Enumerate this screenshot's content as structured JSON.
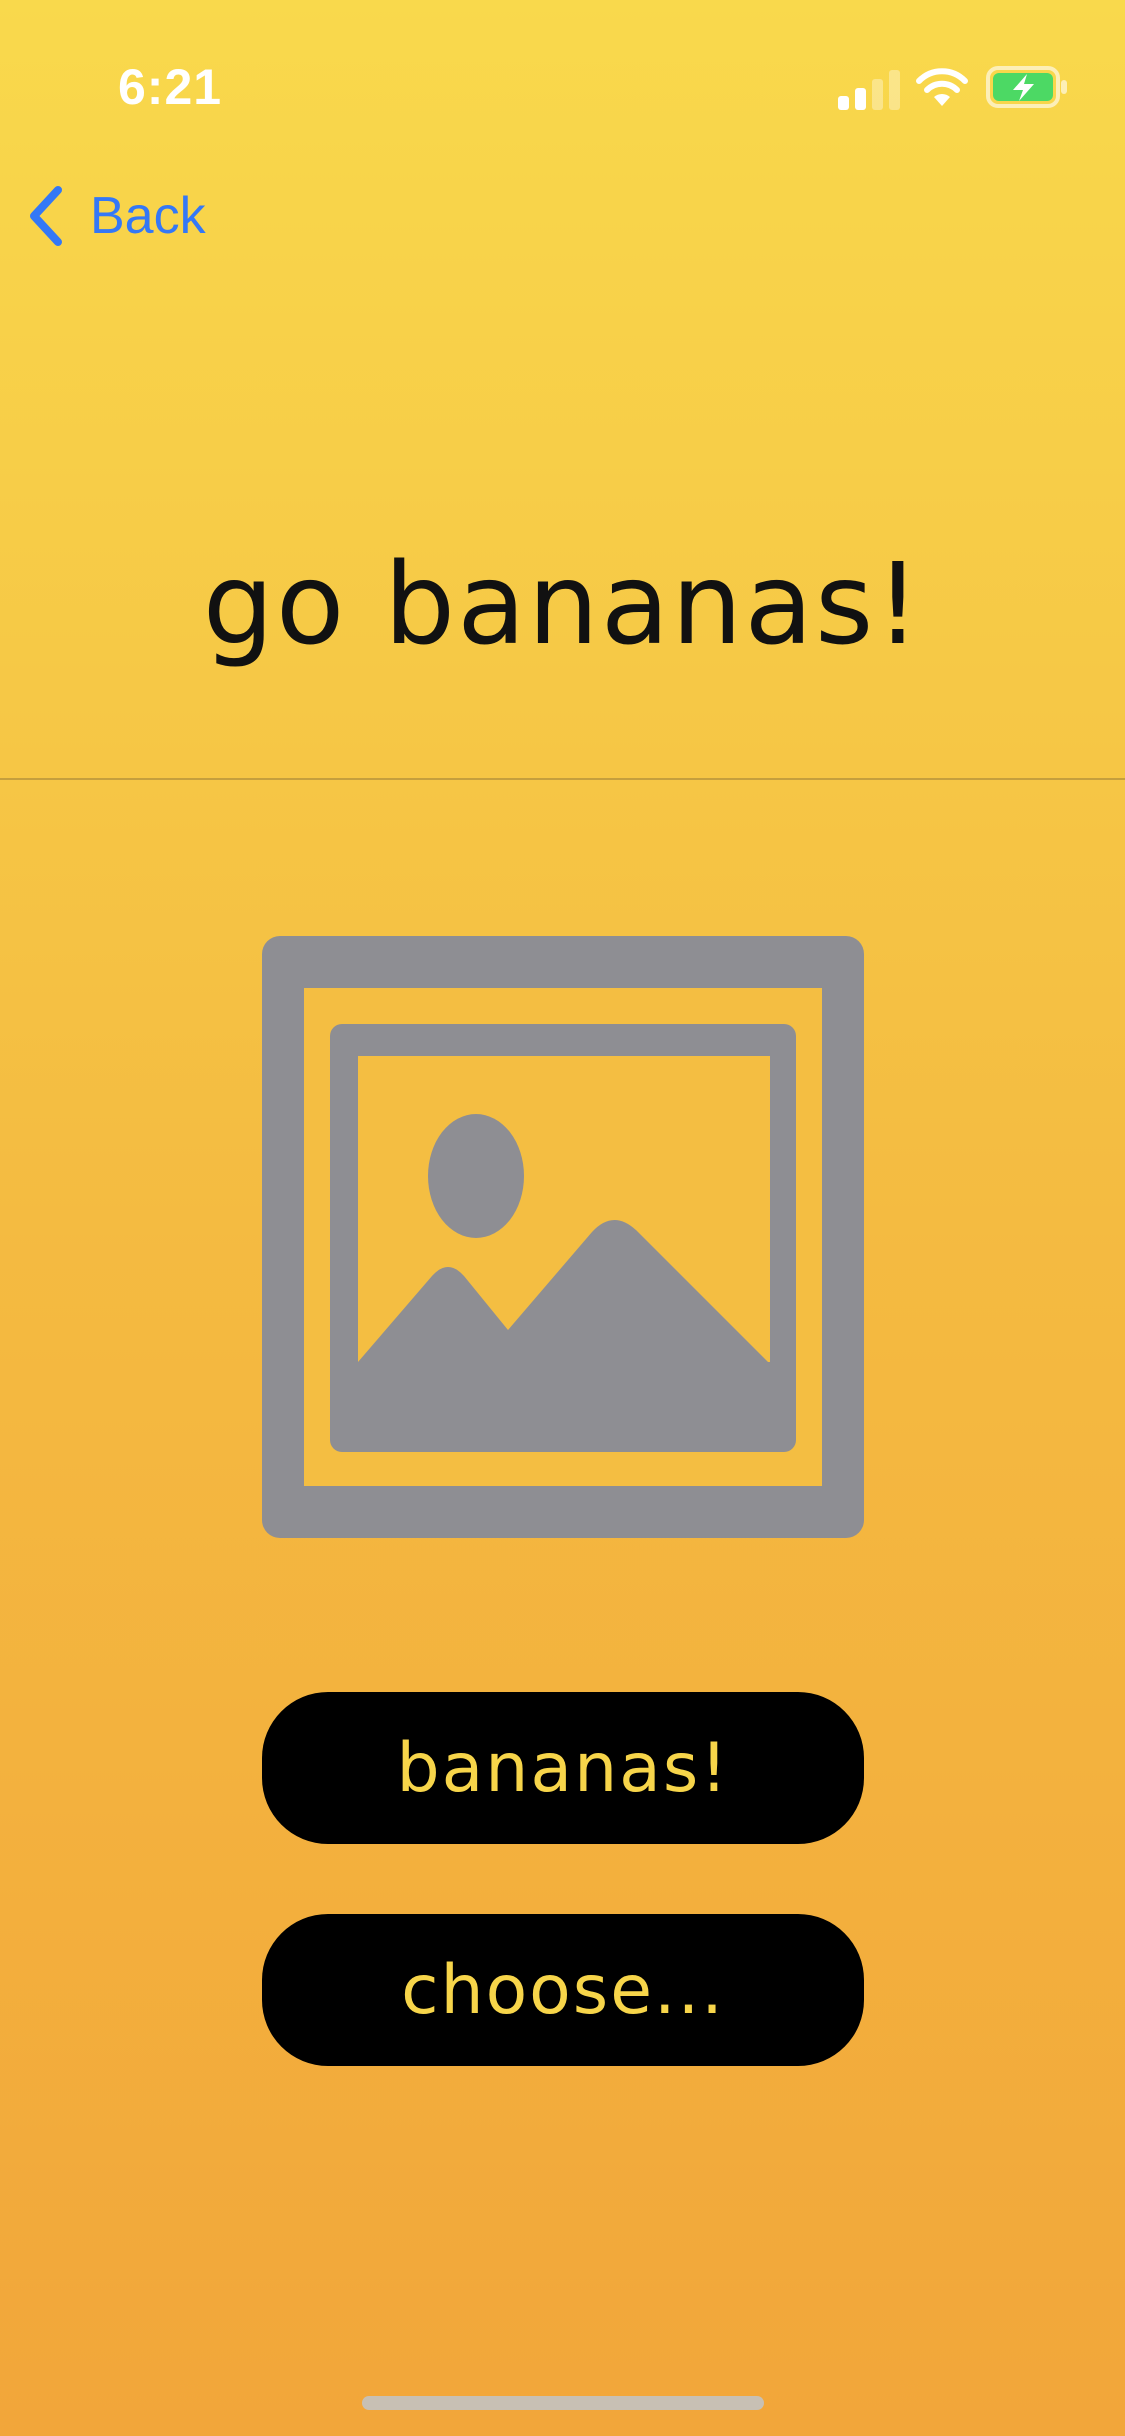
{
  "status_bar": {
    "time": "6:21",
    "signal_icon": "cellular-signal-icon",
    "wifi_icon": "wifi-icon",
    "battery_icon": "battery-charging-icon",
    "battery_color": "#4CD964"
  },
  "navigation": {
    "back_label": "Back",
    "back_icon": "chevron-left-icon",
    "tint_color": "#3478F6"
  },
  "main": {
    "title": "go bananas!",
    "image_icon": "image-placeholder-icon",
    "placeholder_color": "#8E8E93"
  },
  "actions": {
    "bananas_label": "bananas!",
    "choose_label": "choose..."
  },
  "theme": {
    "background_top": "#F9D94C",
    "background_bottom": "#F2A63A",
    "button_background": "#000000",
    "button_text": "#F7D54A"
  }
}
